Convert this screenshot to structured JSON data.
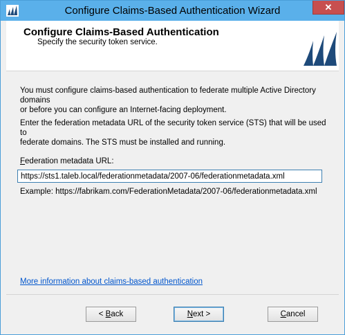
{
  "window": {
    "title": "Configure Claims-Based Authentication Wizard",
    "close_label": "✕"
  },
  "header": {
    "title": "Configure Claims-Based Authentication",
    "subtitle": "Specify the security token service."
  },
  "body": {
    "paragraph1_line1": "You must configure claims-based authentication to federate multiple Active Directory domains",
    "paragraph1_line2": "or before you can configure an Internet-facing deployment.",
    "paragraph2_line1": "Enter the federation metadata URL of the security token service (STS) that will be used to",
    "paragraph2_line2": "federate domains. The STS must be installed and running.",
    "field_label_accel": "F",
    "field_label_rest": "ederation metadata URL:",
    "field_value": "https://sts1.taleb.local/federationmetadata/2007-06/federationmetadata.xml",
    "example": "Example: https://fabrikam.com/FederationMetadata/2007-06/federationmetadata.xml",
    "more_info_link": "More information about claims-based authentication"
  },
  "buttons": {
    "back_prefix": "< ",
    "back_accel": "B",
    "back_rest": "ack",
    "next_accel": "N",
    "next_rest": "ext >",
    "cancel_accel": "C",
    "cancel_rest": "ancel"
  },
  "colors": {
    "titlebar": "#5ab0ea",
    "close_button": "#c74f4f",
    "link": "#0055cc",
    "logo": "#1e4a7a"
  },
  "icons": {
    "app": "wizard-app-icon",
    "logo": "dynamics-logo"
  }
}
